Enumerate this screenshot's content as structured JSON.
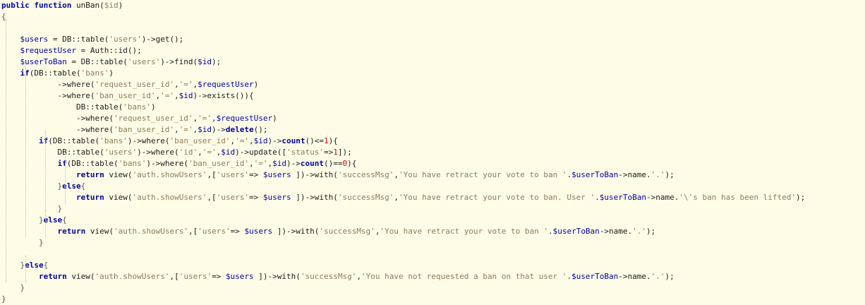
{
  "editor": {
    "background": "#fdfde7",
    "colors": {
      "keyword": "#0000a0",
      "variable": "#0000a0",
      "string": "#8e7a5a",
      "plain": "#1a1a1a",
      "number": "#e00000",
      "brace": "#555555"
    },
    "lines": [
      {
        "segments": [
          {
            "t": "public function",
            "c": "kw"
          },
          {
            "t": " unBan(",
            "c": "pl"
          },
          {
            "t": "$id",
            "c": "str"
          },
          {
            "t": ")",
            "c": "pl"
          }
        ]
      },
      {
        "segments": [
          {
            "t": "{",
            "c": "brace"
          }
        ]
      },
      {
        "segments": []
      },
      {
        "segments": [
          {
            "t": "    ",
            "c": "pl"
          },
          {
            "t": "$users",
            "c": "var"
          },
          {
            "t": " = DB::table(",
            "c": "pl"
          },
          {
            "t": "'users'",
            "c": "str"
          },
          {
            "t": ")->get();",
            "c": "pl"
          }
        ]
      },
      {
        "segments": [
          {
            "t": "    ",
            "c": "pl"
          },
          {
            "t": "$requestUser",
            "c": "var"
          },
          {
            "t": " = Auth::id();",
            "c": "pl"
          }
        ]
      },
      {
        "segments": [
          {
            "t": "    ",
            "c": "pl"
          },
          {
            "t": "$userToBan",
            "c": "var"
          },
          {
            "t": " = DB::table(",
            "c": "pl"
          },
          {
            "t": "'users'",
            "c": "str"
          },
          {
            "t": ")->find(",
            "c": "pl"
          },
          {
            "t": "$id",
            "c": "var"
          },
          {
            "t": ");",
            "c": "pl"
          }
        ]
      },
      {
        "segments": [
          {
            "t": "    ",
            "c": "pl"
          },
          {
            "t": "if",
            "c": "kw"
          },
          {
            "t": "(DB::table(",
            "c": "pl"
          },
          {
            "t": "'bans'",
            "c": "str"
          },
          {
            "t": ")",
            "c": "pl"
          }
        ]
      },
      {
        "segments": [
          {
            "t": "            ->where(",
            "c": "pl"
          },
          {
            "t": "'request_user_id'",
            "c": "str"
          },
          {
            "t": ",",
            "c": "pl"
          },
          {
            "t": "'='",
            "c": "str"
          },
          {
            "t": ",",
            "c": "pl"
          },
          {
            "t": "$requestUser",
            "c": "var"
          },
          {
            "t": ")",
            "c": "pl"
          }
        ]
      },
      {
        "segments": [
          {
            "t": "            ->where(",
            "c": "pl"
          },
          {
            "t": "'ban_user_id'",
            "c": "str"
          },
          {
            "t": ",",
            "c": "pl"
          },
          {
            "t": "'='",
            "c": "str"
          },
          {
            "t": ",",
            "c": "pl"
          },
          {
            "t": "$id",
            "c": "var"
          },
          {
            "t": ")->exists()){",
            "c": "pl"
          }
        ]
      },
      {
        "segments": [
          {
            "t": "                DB::table(",
            "c": "pl"
          },
          {
            "t": "'bans'",
            "c": "str"
          },
          {
            "t": ")",
            "c": "pl"
          }
        ]
      },
      {
        "segments": [
          {
            "t": "                ->where(",
            "c": "pl"
          },
          {
            "t": "'request_user_id'",
            "c": "str"
          },
          {
            "t": ",",
            "c": "pl"
          },
          {
            "t": "'='",
            "c": "str"
          },
          {
            "t": ",",
            "c": "pl"
          },
          {
            "t": "$requestUser",
            "c": "var"
          },
          {
            "t": ")",
            "c": "pl"
          }
        ]
      },
      {
        "segments": [
          {
            "t": "                ->where(",
            "c": "pl"
          },
          {
            "t": "'ban_user_id'",
            "c": "str"
          },
          {
            "t": ",",
            "c": "pl"
          },
          {
            "t": "'='",
            "c": "str"
          },
          {
            "t": ",",
            "c": "pl"
          },
          {
            "t": "$id",
            "c": "var"
          },
          {
            "t": ")->",
            "c": "pl"
          },
          {
            "t": "delete",
            "c": "kw"
          },
          {
            "t": "();",
            "c": "pl"
          }
        ]
      },
      {
        "segments": [
          {
            "t": "        ",
            "c": "pl"
          },
          {
            "t": "if",
            "c": "kw"
          },
          {
            "t": "(DB::table(",
            "c": "pl"
          },
          {
            "t": "'bans'",
            "c": "str"
          },
          {
            "t": ")->where(",
            "c": "pl"
          },
          {
            "t": "'ban_user_id'",
            "c": "str"
          },
          {
            "t": ",",
            "c": "pl"
          },
          {
            "t": "'='",
            "c": "str"
          },
          {
            "t": ",",
            "c": "pl"
          },
          {
            "t": "$id",
            "c": "var"
          },
          {
            "t": ")->",
            "c": "pl"
          },
          {
            "t": "count",
            "c": "kw"
          },
          {
            "t": "()<=",
            "c": "pl"
          },
          {
            "t": "1",
            "c": "num"
          },
          {
            "t": "){",
            "c": "pl"
          }
        ]
      },
      {
        "segments": [
          {
            "t": "            DB::table(",
            "c": "pl"
          },
          {
            "t": "'users'",
            "c": "str"
          },
          {
            "t": ")->where(",
            "c": "pl"
          },
          {
            "t": "'id'",
            "c": "str"
          },
          {
            "t": ",",
            "c": "pl"
          },
          {
            "t": "'='",
            "c": "str"
          },
          {
            "t": ",",
            "c": "pl"
          },
          {
            "t": "$id",
            "c": "var"
          },
          {
            "t": ")->update([",
            "c": "pl"
          },
          {
            "t": "'status'",
            "c": "str"
          },
          {
            "t": "=>",
            "c": "pl"
          },
          {
            "t": "1",
            "c": "num"
          },
          {
            "t": "]);",
            "c": "pl"
          }
        ]
      },
      {
        "segments": [
          {
            "t": "            ",
            "c": "pl"
          },
          {
            "t": "if",
            "c": "kw"
          },
          {
            "t": "(DB::table(",
            "c": "pl"
          },
          {
            "t": "'bans'",
            "c": "str"
          },
          {
            "t": ")->where(",
            "c": "pl"
          },
          {
            "t": "'ban_user_id'",
            "c": "str"
          },
          {
            "t": ",",
            "c": "pl"
          },
          {
            "t": "'='",
            "c": "str"
          },
          {
            "t": ",",
            "c": "pl"
          },
          {
            "t": "$id",
            "c": "var"
          },
          {
            "t": ")->",
            "c": "pl"
          },
          {
            "t": "count",
            "c": "kw"
          },
          {
            "t": "()==",
            "c": "pl"
          },
          {
            "t": "0",
            "c": "num"
          },
          {
            "t": "){",
            "c": "pl"
          }
        ]
      },
      {
        "segments": [
          {
            "t": "                ",
            "c": "pl"
          },
          {
            "t": "return",
            "c": "kw"
          },
          {
            "t": " view(",
            "c": "pl"
          },
          {
            "t": "'auth.showUsers'",
            "c": "str"
          },
          {
            "t": ",[",
            "c": "pl"
          },
          {
            "t": "'users'",
            "c": "str"
          },
          {
            "t": "=> ",
            "c": "pl"
          },
          {
            "t": "$users",
            "c": "var"
          },
          {
            "t": " ])->with(",
            "c": "pl"
          },
          {
            "t": "'successMsg'",
            "c": "str"
          },
          {
            "t": ",",
            "c": "pl"
          },
          {
            "t": "'You have retract your vote to ban '",
            "c": "str"
          },
          {
            "t": ".",
            "c": "pl"
          },
          {
            "t": "$userToBan",
            "c": "var"
          },
          {
            "t": "->name.",
            "c": "pl"
          },
          {
            "t": "'.'",
            "c": "str"
          },
          {
            "t": ");",
            "c": "pl"
          }
        ]
      },
      {
        "segments": [
          {
            "t": "            }",
            "c": "brace"
          },
          {
            "t": "else",
            "c": "kw"
          },
          {
            "t": "{",
            "c": "brace"
          }
        ]
      },
      {
        "segments": [
          {
            "t": "                ",
            "c": "pl"
          },
          {
            "t": "return",
            "c": "kw"
          },
          {
            "t": " view(",
            "c": "pl"
          },
          {
            "t": "'auth.showUsers'",
            "c": "str"
          },
          {
            "t": ",[",
            "c": "pl"
          },
          {
            "t": "'users'",
            "c": "str"
          },
          {
            "t": "=> ",
            "c": "pl"
          },
          {
            "t": "$users",
            "c": "var"
          },
          {
            "t": " ])->with(",
            "c": "pl"
          },
          {
            "t": "'successMsg'",
            "c": "str"
          },
          {
            "t": ",",
            "c": "pl"
          },
          {
            "t": "'You have retract your vote to ban. User '",
            "c": "str"
          },
          {
            "t": ".",
            "c": "pl"
          },
          {
            "t": "$userToBan",
            "c": "var"
          },
          {
            "t": "->name.",
            "c": "pl"
          },
          {
            "t": "'\\'s ban has been lifted'",
            "c": "str"
          },
          {
            "t": ");",
            "c": "pl"
          }
        ]
      },
      {
        "segments": [
          {
            "t": "            }",
            "c": "brace"
          }
        ]
      },
      {
        "segments": [
          {
            "t": "        }",
            "c": "brace"
          },
          {
            "t": "else",
            "c": "kw"
          },
          {
            "t": "{",
            "c": "brace"
          }
        ]
      },
      {
        "segments": [
          {
            "t": "            ",
            "c": "pl"
          },
          {
            "t": "return",
            "c": "kw"
          },
          {
            "t": " view(",
            "c": "pl"
          },
          {
            "t": "'auth.showUsers'",
            "c": "str"
          },
          {
            "t": ",[",
            "c": "pl"
          },
          {
            "t": "'users'",
            "c": "str"
          },
          {
            "t": "=> ",
            "c": "pl"
          },
          {
            "t": "$users",
            "c": "var"
          },
          {
            "t": " ])->with(",
            "c": "pl"
          },
          {
            "t": "'successMsg'",
            "c": "str"
          },
          {
            "t": ",",
            "c": "pl"
          },
          {
            "t": "'You have retract your vote to ban '",
            "c": "str"
          },
          {
            "t": ".",
            "c": "pl"
          },
          {
            "t": "$userToBan",
            "c": "var"
          },
          {
            "t": "->name.",
            "c": "pl"
          },
          {
            "t": "'.'",
            "c": "str"
          },
          {
            "t": ");",
            "c": "pl"
          }
        ]
      },
      {
        "segments": [
          {
            "t": "        }",
            "c": "brace"
          }
        ]
      },
      {
        "segments": []
      },
      {
        "segments": [
          {
            "t": "    }",
            "c": "brace"
          },
          {
            "t": "else",
            "c": "kw"
          },
          {
            "t": "{",
            "c": "brace"
          }
        ]
      },
      {
        "segments": [
          {
            "t": "        ",
            "c": "pl"
          },
          {
            "t": "return",
            "c": "kw"
          },
          {
            "t": " view(",
            "c": "pl"
          },
          {
            "t": "'auth.showUsers'",
            "c": "str"
          },
          {
            "t": ",[",
            "c": "pl"
          },
          {
            "t": "'users'",
            "c": "str"
          },
          {
            "t": "=> ",
            "c": "pl"
          },
          {
            "t": "$users",
            "c": "var"
          },
          {
            "t": " ])->with(",
            "c": "pl"
          },
          {
            "t": "'successMsg'",
            "c": "str"
          },
          {
            "t": ",",
            "c": "pl"
          },
          {
            "t": "'You have not requested a ban on that user '",
            "c": "str"
          },
          {
            "t": ".",
            "c": "pl"
          },
          {
            "t": "$userToBan",
            "c": "var"
          },
          {
            "t": "->name.",
            "c": "pl"
          },
          {
            "t": "'.'",
            "c": "str"
          },
          {
            "t": ");",
            "c": "pl"
          }
        ]
      },
      {
        "segments": [
          {
            "t": "    }",
            "c": "brace"
          }
        ]
      },
      {
        "segments": [
          {
            "t": "}",
            "c": "brace"
          }
        ]
      }
    ]
  }
}
